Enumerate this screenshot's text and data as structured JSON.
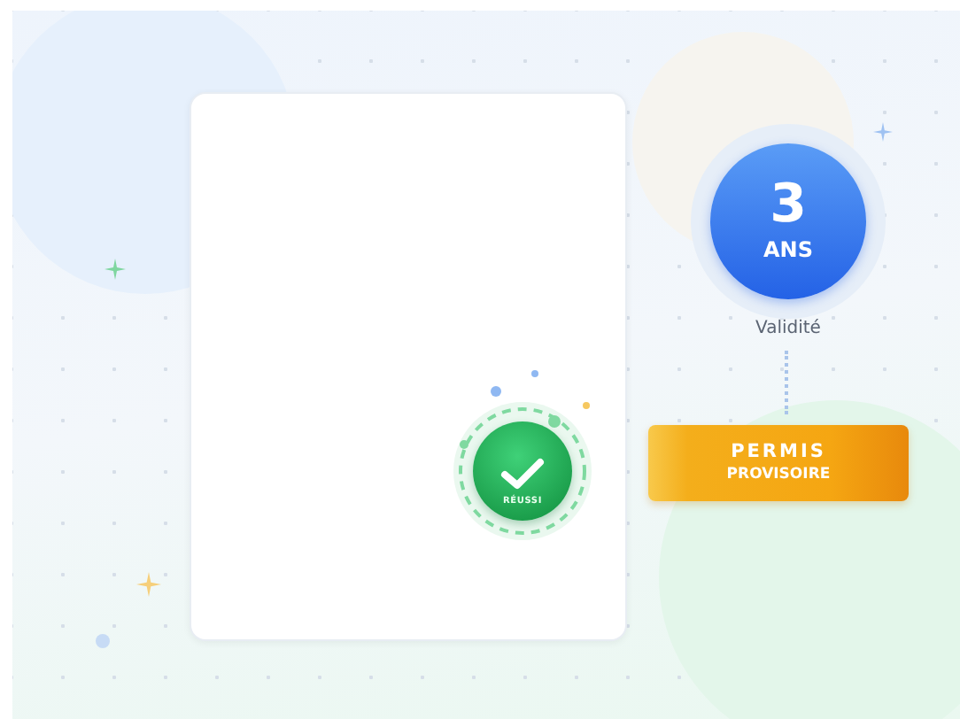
{
  "stamp": {
    "text": "RÉUSSI"
  },
  "validity_badge": {
    "number": "3",
    "unit": "ANS",
    "caption": "Validité"
  },
  "ribbon": {
    "lines": [
      "PERMIS",
      "PROVISOIRE"
    ]
  }
}
